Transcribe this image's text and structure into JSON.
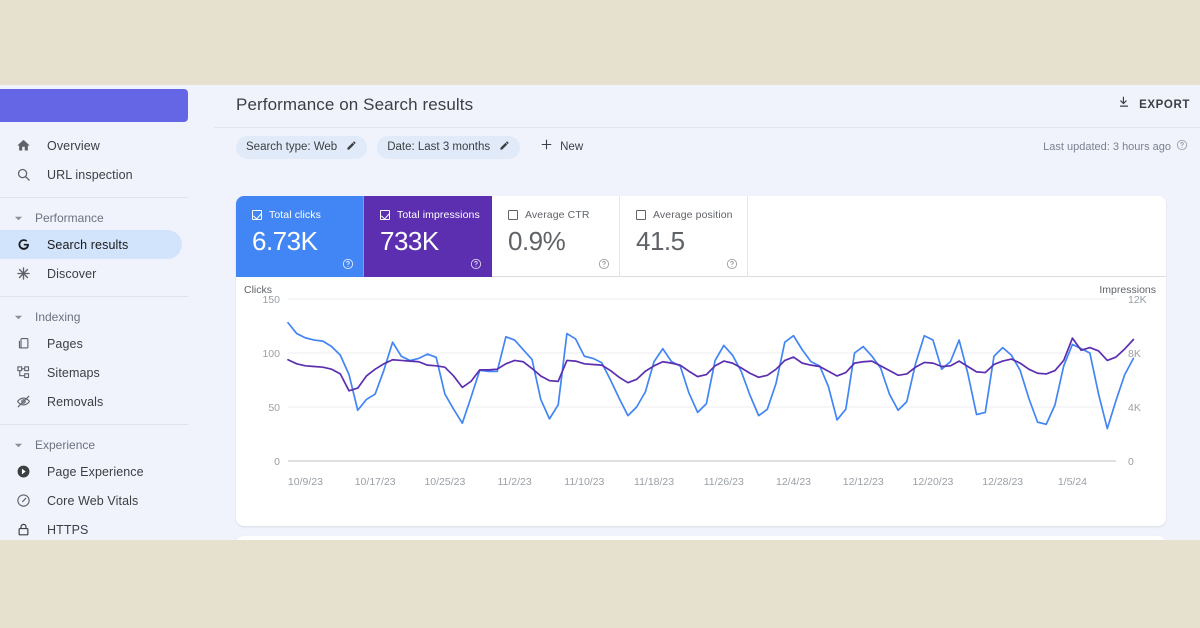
{
  "colors": {
    "page_background": "#e6e0ce",
    "app_background": "#f1f3fc",
    "site_bar": "#6466e6",
    "clicks": "#4285f4",
    "impressions": "#5b2fb0",
    "active_nav": "#d2e3fc"
  },
  "sidebar": {
    "items": [
      {
        "label": "Overview",
        "icon": "home-icon",
        "type": "item",
        "active": false
      },
      {
        "label": "URL inspection",
        "icon": "search-icon",
        "type": "item",
        "active": false
      },
      {
        "label": "Performance",
        "icon": "chevron-down-icon",
        "type": "group"
      },
      {
        "label": "Search results",
        "icon": "google-g-icon",
        "type": "item",
        "active": true
      },
      {
        "label": "Discover",
        "icon": "sparkle-icon",
        "type": "item",
        "active": false
      },
      {
        "label": "Indexing",
        "icon": "chevron-down-icon",
        "type": "group"
      },
      {
        "label": "Pages",
        "icon": "pages-icon",
        "type": "item",
        "active": false
      },
      {
        "label": "Sitemaps",
        "icon": "sitemap-icon",
        "type": "item",
        "active": false
      },
      {
        "label": "Removals",
        "icon": "eye-off-icon",
        "type": "item",
        "active": false
      },
      {
        "label": "Experience",
        "icon": "chevron-down-icon",
        "type": "group"
      },
      {
        "label": "Page Experience",
        "icon": "page-experience-icon",
        "type": "item",
        "active": false
      },
      {
        "label": "Core Web Vitals",
        "icon": "speedometer-icon",
        "type": "item",
        "active": false
      },
      {
        "label": "HTTPS",
        "icon": "lock-icon",
        "type": "item",
        "active": false
      }
    ]
  },
  "header": {
    "title": "Performance on Search results",
    "export_label": "EXPORT",
    "export_icon": "download-icon"
  },
  "filters": {
    "chips": [
      {
        "label": "Search type: Web",
        "icon": "pencil-icon"
      },
      {
        "label": "Date: Last 3 months",
        "icon": "pencil-icon"
      }
    ],
    "new_label": "New",
    "new_icon": "plus-icon",
    "last_updated": "Last updated: 3 hours ago",
    "last_updated_icon": "help-circle-icon"
  },
  "metrics": [
    {
      "label": "Total clicks",
      "value": "6.73K",
      "checked": true,
      "theme": "clicks"
    },
    {
      "label": "Total impressions",
      "value": "733K",
      "checked": true,
      "theme": "impressions"
    },
    {
      "label": "Average CTR",
      "value": "0.9%",
      "checked": false,
      "theme": "plain"
    },
    {
      "label": "Average position",
      "value": "41.5",
      "checked": false,
      "theme": "plain"
    }
  ],
  "chart_data": {
    "type": "line",
    "title": "",
    "xlabel": "",
    "ylabel": "Clicks",
    "y2label": "Impressions",
    "grid": true,
    "legend_position": "none",
    "y_left_ticks": [
      "0",
      "50",
      "100",
      "150"
    ],
    "y_left_values": [
      0,
      50,
      100,
      150
    ],
    "ylim": [
      0,
      150
    ],
    "y_right_ticks": [
      "0",
      "4K",
      "8K",
      "12K"
    ],
    "y_right_values": [
      0,
      4000,
      8000,
      12000
    ],
    "y2lim": [
      0,
      12000
    ],
    "x_tick_labels": [
      "10/9/23",
      "10/17/23",
      "10/25/23",
      "11/2/23",
      "11/10/23",
      "11/18/23",
      "11/26/23",
      "12/4/23",
      "12/12/23",
      "12/20/23",
      "12/28/23",
      "1/5/24"
    ],
    "x_tick_positions": [
      2,
      10,
      18,
      26,
      34,
      42,
      50,
      58,
      66,
      74,
      82,
      90
    ],
    "n_points": 96,
    "series": [
      {
        "name": "Clicks",
        "color": "#4285f4",
        "axis": "left",
        "values": [
          128,
          118,
          114,
          112,
          111,
          106,
          98,
          80,
          47,
          57,
          62,
          84,
          110,
          97,
          93,
          95,
          99,
          96,
          62,
          48,
          35,
          59,
          84,
          83,
          83,
          115,
          112,
          103,
          94,
          57,
          39,
          52,
          118,
          113,
          97,
          95,
          91,
          75,
          58,
          42,
          50,
          64,
          92,
          104,
          92,
          88,
          63,
          45,
          53,
          93,
          107,
          98,
          83,
          61,
          42,
          48,
          72,
          110,
          116,
          103,
          92,
          88,
          69,
          38,
          48,
          100,
          106,
          97,
          86,
          62,
          47,
          55,
          90,
          116,
          112,
          85,
          92,
          112,
          81,
          43,
          45,
          97,
          105,
          98,
          84,
          58,
          36,
          34,
          52,
          88,
          108,
          104,
          100,
          62,
          30,
          56,
          80,
          95
        ]
      },
      {
        "name": "Impressions",
        "color": "#5b2fb0",
        "axis": "right",
        "values": [
          7500,
          7200,
          7050,
          7000,
          6950,
          6800,
          6450,
          5200,
          5400,
          6300,
          6800,
          7200,
          7500,
          7450,
          7400,
          7350,
          7100,
          7050,
          6950,
          6300,
          5450,
          5900,
          6750,
          6750,
          6800,
          7200,
          7450,
          7350,
          6850,
          6300,
          5950,
          5900,
          7450,
          7400,
          7200,
          7150,
          7100,
          6700,
          6200,
          5800,
          6050,
          6650,
          7050,
          7350,
          7250,
          7100,
          6650,
          6250,
          6400,
          7050,
          7400,
          7250,
          6900,
          6500,
          6200,
          6350,
          6800,
          7450,
          7700,
          7250,
          7100,
          7000,
          6650,
          6300,
          6550,
          7250,
          7350,
          7400,
          7050,
          6700,
          6350,
          6450,
          6950,
          7300,
          7250,
          7000,
          7050,
          7400,
          7000,
          6600,
          6550,
          7150,
          7400,
          7550,
          7250,
          6800,
          6500,
          6450,
          6700,
          7450,
          9100,
          8200,
          8400,
          8150,
          7450,
          7700,
          8300,
          9000
        ]
      }
    ]
  }
}
